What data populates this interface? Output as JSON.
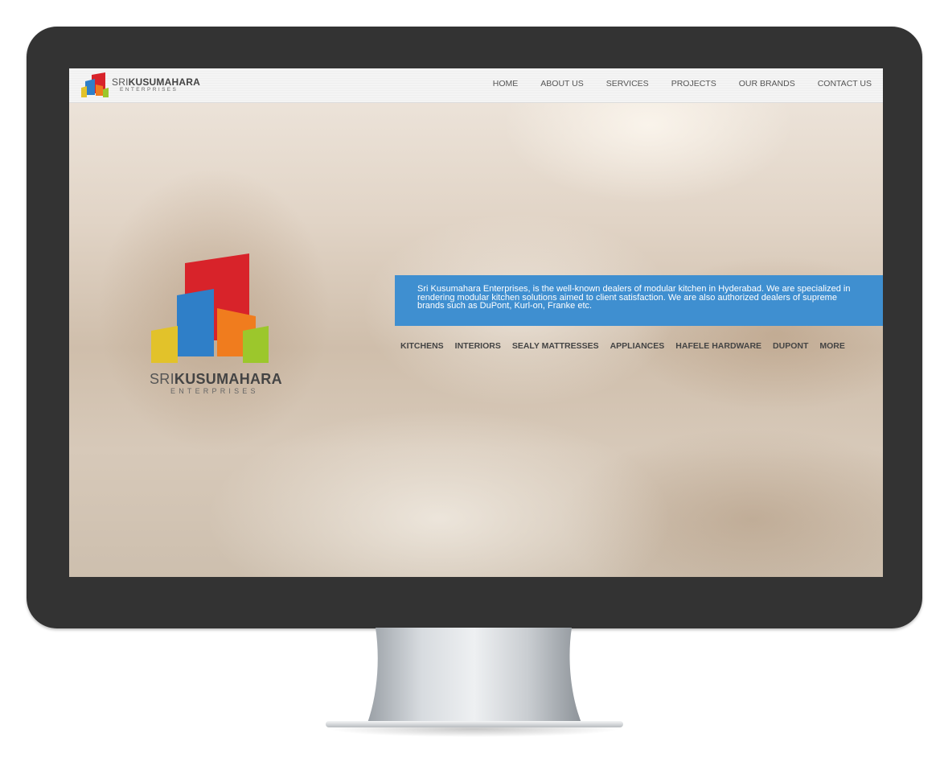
{
  "site": {
    "brand_prefix": "SRI",
    "brand_name": "KUSUMAHARA",
    "brand_sub": "ENTERPRISES"
  },
  "nav": {
    "items": [
      "HOME",
      "ABOUT US",
      "SERVICES",
      "PROJECTS",
      "OUR BRANDS",
      "CONTACT US"
    ]
  },
  "hero": {
    "description": "Sri Kusumahara Enterprises, is the well-known dealers of modular kitchen in Hyderabad. We are specialized in rendering modular kitchen solutions aimed to client satisfaction. We are also authorized dealers of supreme brands such as DuPont, Kurl-on, Franke etc.",
    "links": [
      "KITCHENS",
      "INTERIORS",
      "SEALY MATTRESSES",
      "APPLIANCES",
      "HAFELE HARDWARE",
      "DUPONT",
      "MORE"
    ]
  },
  "colors": {
    "info_box": "#3f8fd0",
    "monitor_bezel": "#333333",
    "logo_red": "#d8232a",
    "logo_blue": "#2f7fc8",
    "logo_orange": "#f07c1e",
    "logo_yellow": "#e2c22a",
    "logo_green": "#9cc72c"
  }
}
